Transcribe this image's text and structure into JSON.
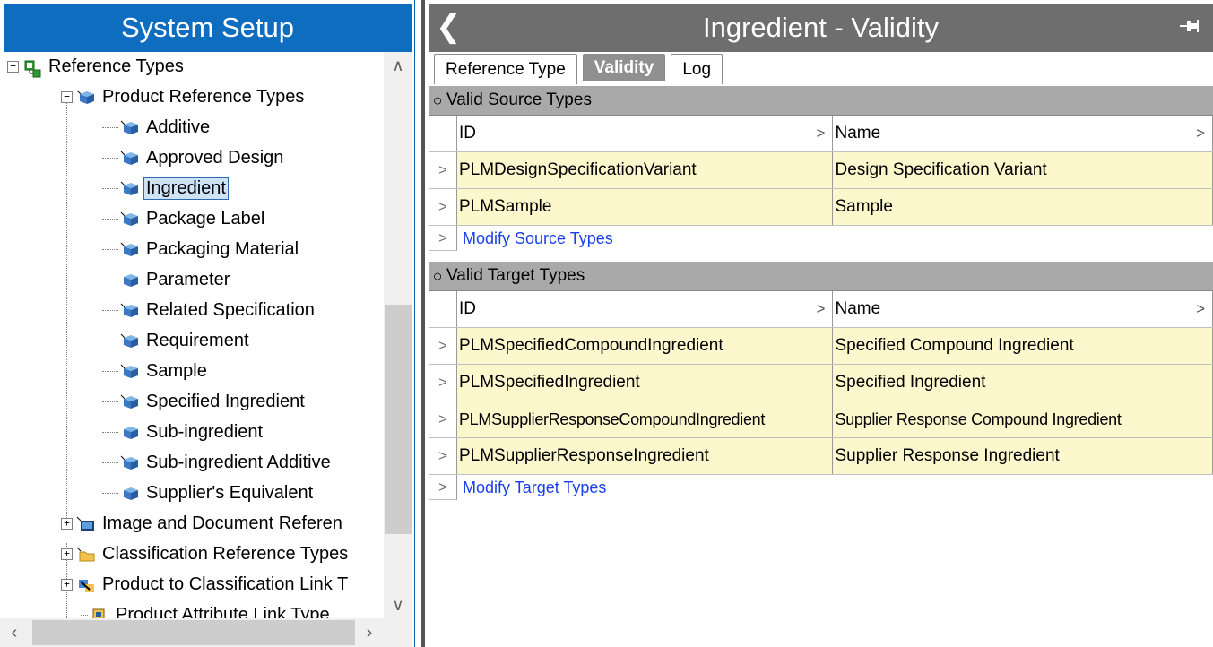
{
  "left": {
    "title": "System Setup",
    "tree": [
      {
        "label": "Reference Types",
        "expander": "⊟"
      },
      {
        "label": "Product Reference Types",
        "expander": "⊟"
      },
      {
        "label": "Additive"
      },
      {
        "label": "Approved Design"
      },
      {
        "label": "Ingredient",
        "selected": true
      },
      {
        "label": "Package Label"
      },
      {
        "label": "Packaging Material"
      },
      {
        "label": "Parameter"
      },
      {
        "label": "Related Specification"
      },
      {
        "label": "Requirement"
      },
      {
        "label": "Sample"
      },
      {
        "label": "Specified Ingredient"
      },
      {
        "label": "Sub-ingredient"
      },
      {
        "label": "Sub-ingredient Additive"
      },
      {
        "label": "Supplier's Equivalent"
      },
      {
        "label": "Image and Document Referen",
        "expander": "⊞"
      },
      {
        "label": "Classification Reference Types",
        "expander": "⊞"
      },
      {
        "label": "Product to Classification Link T",
        "expander": "⊞"
      },
      {
        "label": "Product Attribute Link Type"
      }
    ],
    "icons": {
      "reference_types": "reference-types-icon",
      "cube": "blue-cube-icon",
      "image": "image-doc-icon",
      "folder": "folder-icon",
      "link": "product-classification-link-icon",
      "attr": "attribute-link-icon"
    }
  },
  "right": {
    "title": "Ingredient - Validity",
    "back_glyph": "❮",
    "pin_glyph": "⊣⊢",
    "tabs": [
      "Reference Type",
      "Validity",
      "Log"
    ],
    "active_tab": "Validity",
    "source": {
      "heading": "Valid Source Types",
      "col_id": "ID",
      "col_name": "Name",
      "rows": [
        {
          "id": "PLMDesignSpecificationVariant",
          "name": "Design Specification Variant"
        },
        {
          "id": "PLMSample",
          "name": "Sample"
        }
      ],
      "action": "Modify Source Types"
    },
    "target": {
      "heading": "Valid Target Types",
      "col_id": "ID",
      "col_name": "Name",
      "rows": [
        {
          "id": "PLMSpecifiedCompoundIngredient",
          "name": "Specified Compound Ingredient"
        },
        {
          "id": "PLMSpecifiedIngredient",
          "name": "Specified Ingredient"
        },
        {
          "id": "PLMSupplierResponseCompoundIngredient",
          "name": "Supplier Response Compound Ingredient"
        },
        {
          "id": "PLMSupplierResponseIngredient",
          "name": "Supplier Response Ingredient"
        }
      ],
      "action": "Modify Target Types"
    }
  },
  "colors": {
    "left_header": "#0f6dbf",
    "right_header": "#6e6e6e",
    "row_highlight": "#fdf7cd",
    "link": "#1a3fe6"
  }
}
